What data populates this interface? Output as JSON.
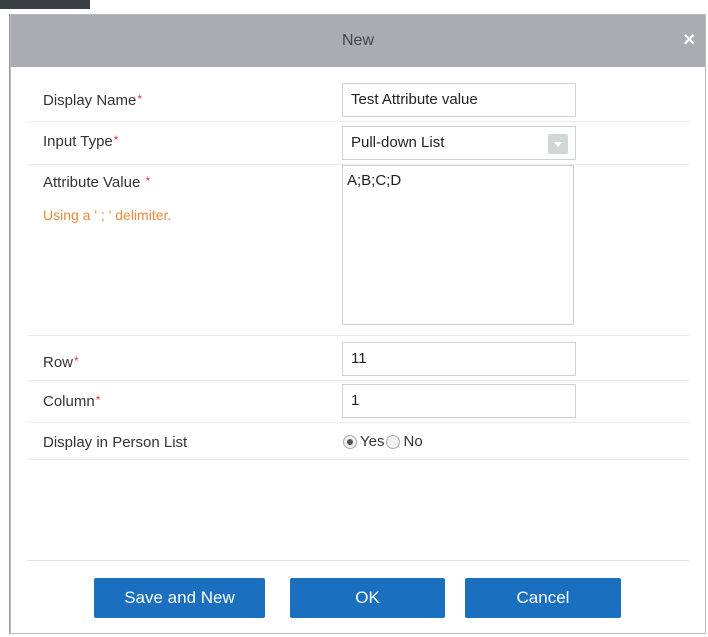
{
  "dialog": {
    "title": "New",
    "close_glyph": "×"
  },
  "form": {
    "display_name": {
      "label": "Display Name",
      "value": "Test Attribute value"
    },
    "input_type": {
      "label": "Input Type",
      "value": "Pull-down List"
    },
    "attribute_value": {
      "label": "Attribute Value ",
      "hint": "Using a ' ; ' delimiter.",
      "value": "A;B;C;D"
    },
    "row": {
      "label": "Row",
      "value": "11"
    },
    "column": {
      "label": "Column",
      "value": "1"
    },
    "display_in_person_list": {
      "label": "Display in Person List",
      "options": [
        "Yes",
        "No"
      ],
      "selected": "Yes"
    },
    "required_mark": "*"
  },
  "buttons": {
    "save_and_new": "Save and New",
    "ok": "OK",
    "cancel": "Cancel"
  },
  "colors": {
    "titlebar": "#a9adb2",
    "button": "#1a6fbf",
    "required": "#e4393c",
    "hint": "#e68a3a"
  }
}
